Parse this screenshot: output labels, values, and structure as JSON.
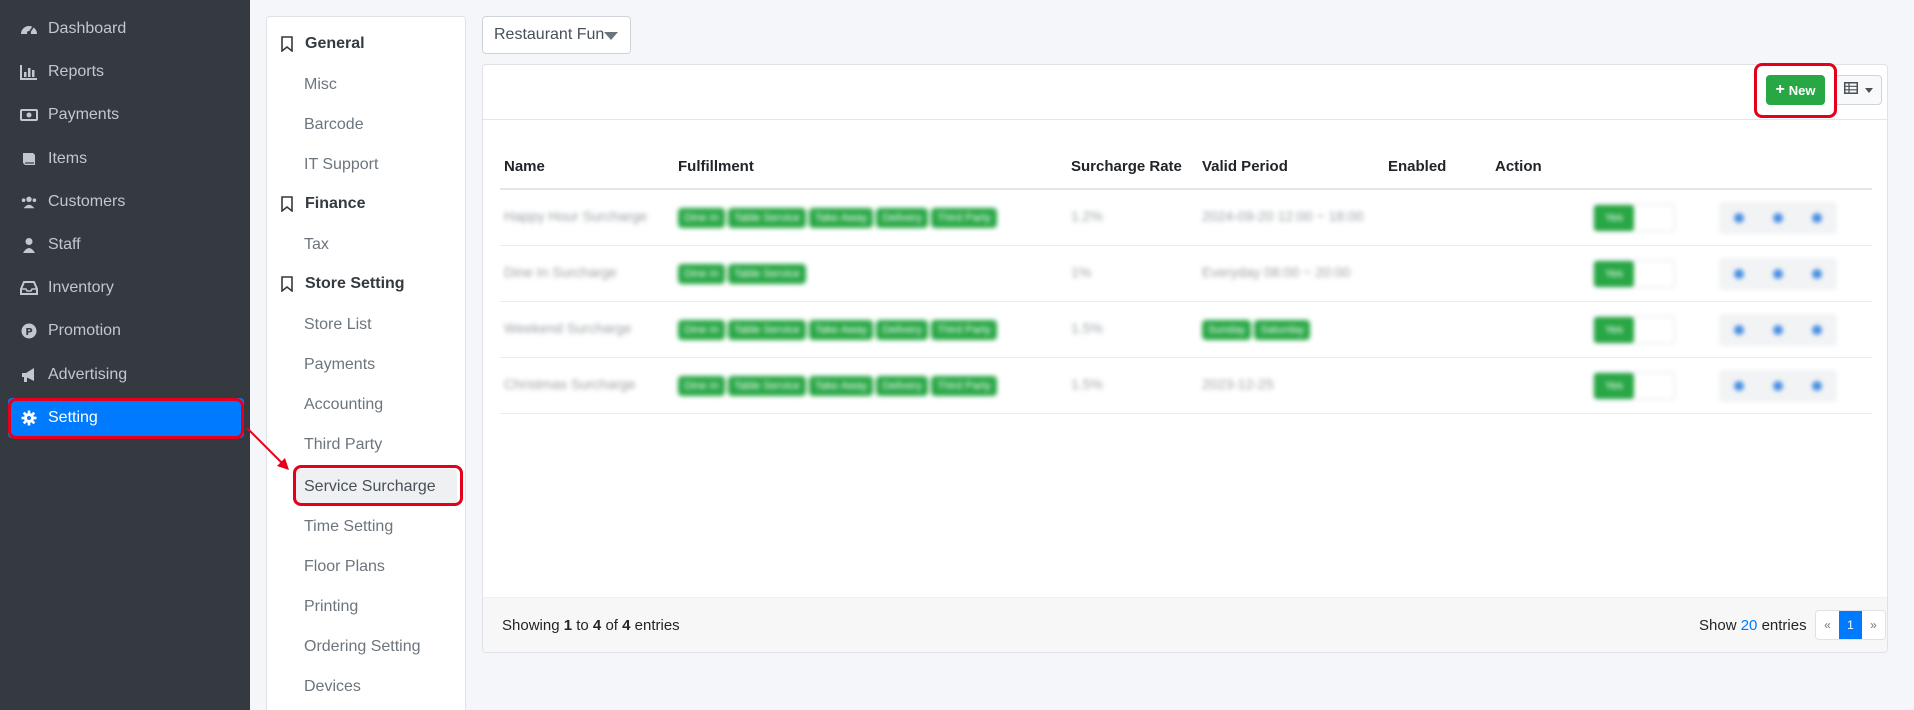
{
  "sidebar": {
    "items": [
      {
        "label": "Dashboard",
        "icon": "dashboard-icon"
      },
      {
        "label": "Reports",
        "icon": "bar-chart-icon"
      },
      {
        "label": "Payments",
        "icon": "money-bill-icon"
      },
      {
        "label": "Items",
        "icon": "book-icon"
      },
      {
        "label": "Customers",
        "icon": "users-icon"
      },
      {
        "label": "Staff",
        "icon": "user-tie-icon"
      },
      {
        "label": "Inventory",
        "icon": "inbox-icon"
      },
      {
        "label": "Promotion",
        "icon": "parking-icon"
      },
      {
        "label": "Advertising",
        "icon": "bullhorn-icon"
      },
      {
        "label": "Setting",
        "icon": "gear-icon",
        "active": true
      }
    ]
  },
  "settings_menu": {
    "general_header": "General",
    "general_items": [
      "Misc",
      "Barcode",
      "IT Support"
    ],
    "finance_header": "Finance",
    "finance_items": [
      "Tax"
    ],
    "store_header": "Store Setting",
    "store_items": [
      "Store List",
      "Payments",
      "Accounting",
      "Third Party",
      "Service Surcharge",
      "Time Setting",
      "Floor Plans",
      "Printing",
      "Ordering Setting",
      "Devices"
    ],
    "active_item": "Service Surcharge"
  },
  "store_select": {
    "value": "Restaurant Fun"
  },
  "toolbar": {
    "new_label": "New"
  },
  "table": {
    "columns": [
      "Name",
      "Fulfillment",
      "Surcharge Rate",
      "Valid Period",
      "Enabled",
      "Action"
    ],
    "rows": [
      {
        "name": "Happy Hour Surcharge",
        "fulfillment": [
          "Dine In",
          "Table Service",
          "Take Away",
          "Delivery",
          "Third Party"
        ],
        "rate": "1.2%",
        "period": "2024-09-20 12:00 ~ 18:00",
        "period_tags": [],
        "enabled": "Yes"
      },
      {
        "name": "Dine In Surcharge",
        "fulfillment": [
          "Dine In",
          "Table Service"
        ],
        "rate": "1%",
        "period": "Everyday 08:00 ~ 20:00",
        "period_tags": [],
        "enabled": "Yes"
      },
      {
        "name": "Weekend Surcharge",
        "fulfillment": [
          "Dine In",
          "Table Service",
          "Take Away",
          "Delivery",
          "Third Party"
        ],
        "rate": "1.5%",
        "period": "",
        "period_tags": [
          "Sunday",
          "Saturday"
        ],
        "enabled": "Yes"
      },
      {
        "name": "Christmas Surcharge",
        "fulfillment": [
          "Dine In",
          "Table Service",
          "Take Away",
          "Delivery",
          "Third Party"
        ],
        "rate": "1.5%",
        "period": "2023-12-25",
        "period_tags": [],
        "enabled": "Yes"
      }
    ]
  },
  "footer": {
    "showing_prefix": "Showing",
    "from": "1",
    "to_word": "to",
    "to": "4",
    "of_word": "of",
    "total": "4",
    "entries_word": "entries",
    "show_word": "Show",
    "page_size": "20",
    "entries_word2": "entries",
    "prev": "«",
    "current_page": "1",
    "next": "»"
  },
  "colors": {
    "sidebar_bg": "#343a40",
    "active_blue": "#007bff",
    "success_green": "#28a745",
    "callout_red": "#e4001b"
  }
}
